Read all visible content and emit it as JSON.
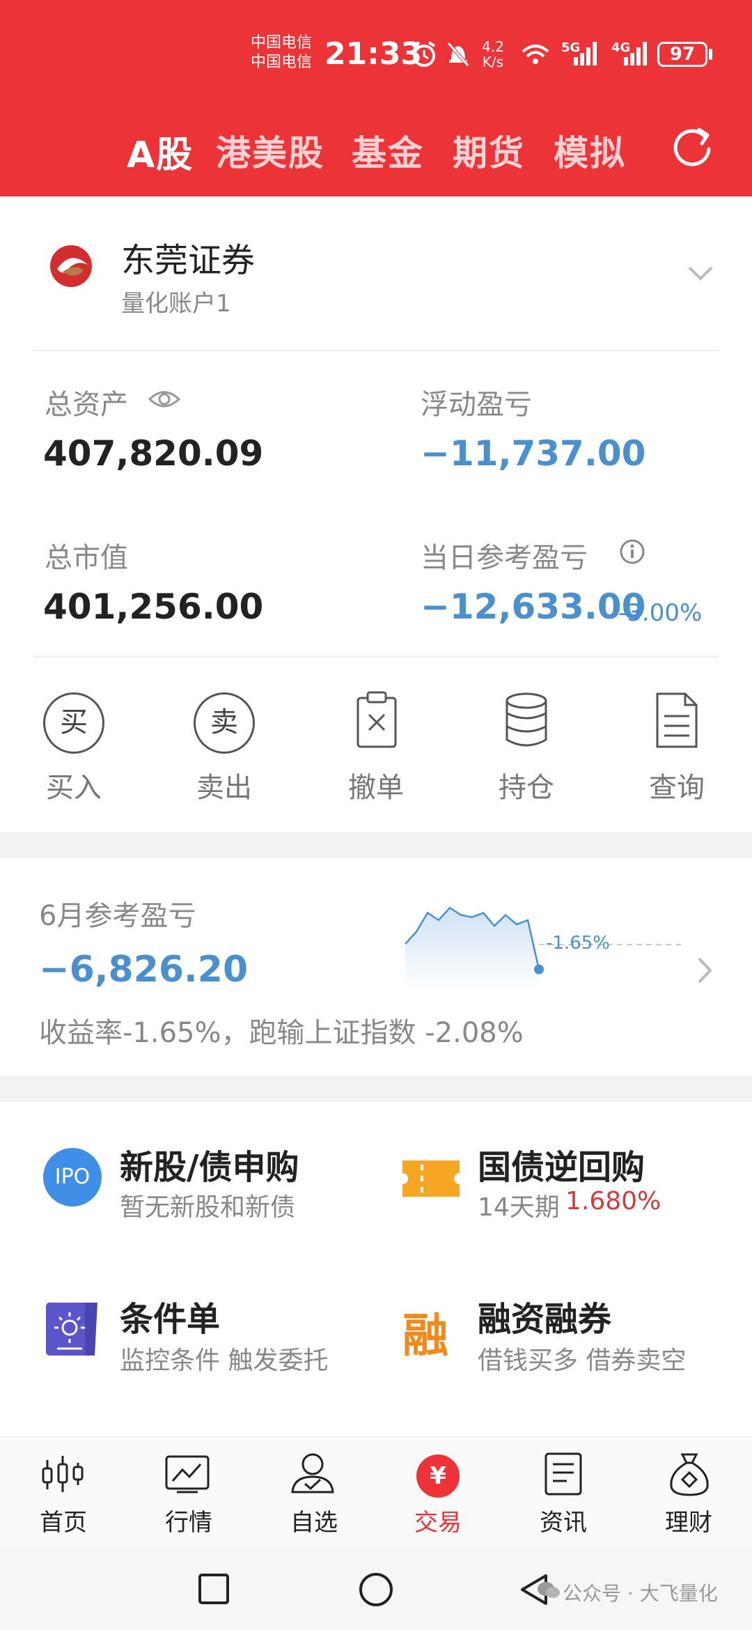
{
  "status_bar": {
    "carrier1": "中国电信",
    "carrier2": "中国电信",
    "time": "21:33",
    "speed_value": "4.2",
    "speed_unit": "K/s",
    "battery": "97"
  },
  "top_tabs": [
    "A股",
    "港美股",
    "基金",
    "期货",
    "模拟"
  ],
  "broker": {
    "name": "东莞证券",
    "account": "量化账户1"
  },
  "assets": {
    "total_assets_label": "总资产",
    "total_assets": "407,820.09",
    "floating_pl_label": "浮动盈亏",
    "floating_pl": "−11,737.00",
    "market_value_label": "总市值",
    "market_value": "401,256.00",
    "daily_pl_label": "当日参考盈亏",
    "daily_pl": "−12,633.00",
    "daily_pl_pct": "-3.00%"
  },
  "actions": [
    {
      "label": "买入",
      "icon_text": "买"
    },
    {
      "label": "卖出",
      "icon_text": "卖"
    },
    {
      "label": "撤单"
    },
    {
      "label": "持仓"
    },
    {
      "label": "查询"
    }
  ],
  "monthly": {
    "title": "6月参考盈亏",
    "value": "−6,826.20",
    "summary": "收益率-1.65%，跑输上证指数 -2.08%",
    "spark_label": "-1.65%",
    "spark_points": [
      0.45,
      0.62,
      0.88,
      0.78,
      0.95,
      0.85,
      0.82,
      0.88,
      0.7,
      0.85,
      0.72,
      0.78,
      0.1
    ]
  },
  "services": [
    {
      "title": "新股/债申购",
      "subtitle": "暂无新股和新债",
      "icon_text": "IPO"
    },
    {
      "title": "国债逆回购",
      "subtitle": "14天期",
      "rate": "1.680%"
    },
    {
      "title": "条件单",
      "subtitle": "监控条件 触发委托"
    },
    {
      "title": "融资融券",
      "subtitle": "借钱买多 借券卖空",
      "icon_text": "融"
    }
  ],
  "bottom_nav": [
    {
      "label": "首页"
    },
    {
      "label": "行情"
    },
    {
      "label": "自选"
    },
    {
      "label": "交易",
      "icon_text": "¥"
    },
    {
      "label": "资讯"
    },
    {
      "label": "理财"
    }
  ],
  "watermark": "公众号 · 大飞量化",
  "colors": {
    "brand_red": "#eb3338",
    "loss_blue": "#4a90cf",
    "rate_red": "#d23b3b",
    "ipo_blue": "#3f8fe8",
    "repo_orange": "#f5a623",
    "cond_purple": "#5a55c9",
    "margin_orange": "#f08a1d"
  }
}
